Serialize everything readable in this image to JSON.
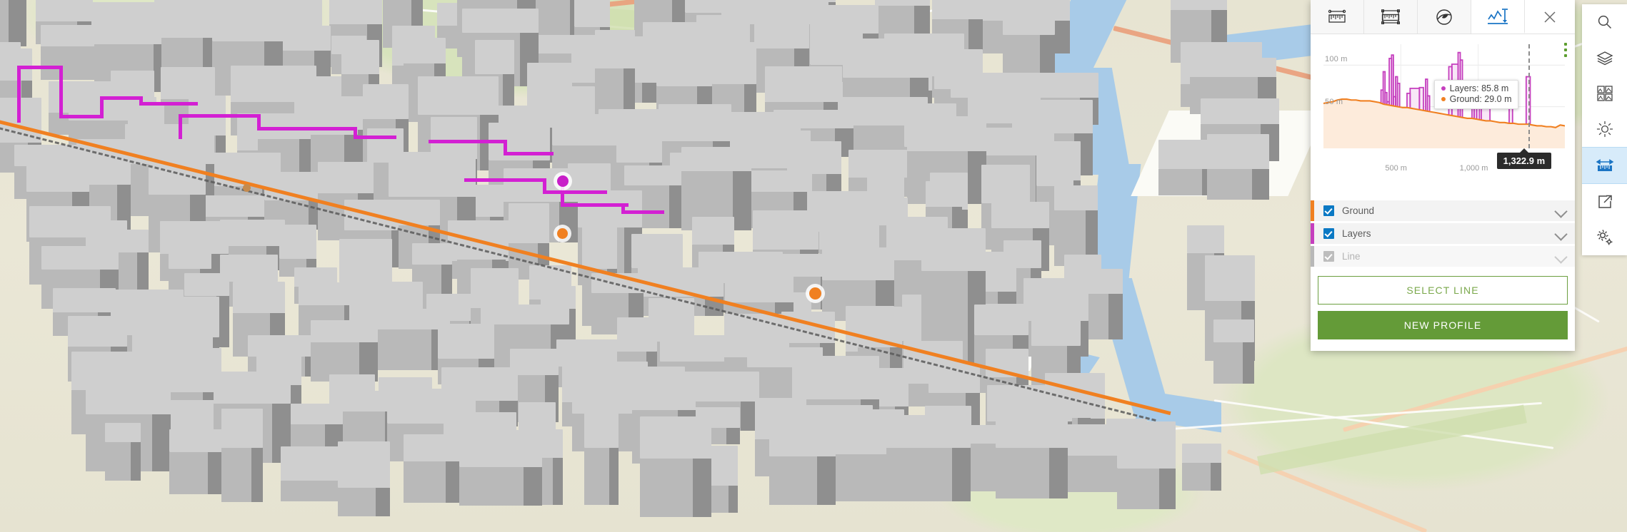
{
  "panel": {
    "tabs": [
      {
        "id": "direct-line-measurement",
        "label": "Direct line measurement",
        "icon": "ruler-icon",
        "active": false
      },
      {
        "id": "area-measurement",
        "label": "Area measurement",
        "icon": "area-ruler-icon",
        "active": false
      },
      {
        "id": "slice",
        "label": "Slice",
        "icon": "slice-icon",
        "active": false
      },
      {
        "id": "elevation-profile",
        "label": "Elevation profile",
        "icon": "elevation-profile-icon",
        "active": true
      }
    ],
    "close_label": "Close",
    "menu_label": "More options",
    "legend": [
      {
        "name": "Ground",
        "color": "#f08021",
        "checked": true,
        "enabled": true
      },
      {
        "name": "Layers",
        "color": "#c53fbe",
        "checked": true,
        "enabled": true
      },
      {
        "name": "Line",
        "color": "#b8b8b8",
        "checked": true,
        "enabled": false
      }
    ],
    "buttons": {
      "select_line": "SELECT LINE",
      "new_profile": "NEW PROFILE"
    },
    "tooltip": {
      "layers_label": "Layers: 85.8 m",
      "ground_label": "Ground: 29.0 m",
      "layers_color": "#c53fbe",
      "ground_color": "#f08021"
    },
    "hover_distance": "1,322.9 m"
  },
  "rail": {
    "items": [
      {
        "id": "search",
        "label": "Search",
        "icon": "search-icon",
        "active": false
      },
      {
        "id": "layers",
        "label": "Layers",
        "icon": "layers-icon",
        "active": false
      },
      {
        "id": "basemap",
        "label": "Basemap gallery",
        "icon": "basemap-gallery-icon",
        "active": false
      },
      {
        "id": "daylight",
        "label": "Daylight",
        "icon": "sun-icon",
        "active": false
      },
      {
        "id": "measurement",
        "label": "Measurement",
        "icon": "measurement-icon",
        "active": true
      },
      {
        "id": "share",
        "label": "Share",
        "icon": "share-icon",
        "active": false
      },
      {
        "id": "settings",
        "label": "Settings",
        "icon": "settings-gear-icon",
        "active": false
      }
    ]
  },
  "chart_data": {
    "type": "area",
    "title": "",
    "xlabel": "",
    "ylabel": "",
    "xlim": [
      0,
      1560
    ],
    "ylim": [
      0,
      125
    ],
    "grid": true,
    "legend_position": "below",
    "yticks": [
      50,
      100
    ],
    "ytick_labels": [
      "50 m",
      "100 m"
    ],
    "xticks": [
      500,
      1000
    ],
    "xtick_labels": [
      "500 m",
      "1,000 m"
    ],
    "cursor": {
      "x": 1322.9,
      "label": "1,322.9 m",
      "layers": 85.8,
      "ground": 29.0
    },
    "series": [
      {
        "name": "Ground",
        "color": "#f08021",
        "fill": "#fdebdb",
        "x": [
          0,
          30,
          60,
          90,
          120,
          150,
          180,
          210,
          240,
          270,
          300,
          330,
          360,
          390,
          420,
          450,
          480,
          510,
          540,
          570,
          600,
          630,
          660,
          690,
          720,
          750,
          780,
          810,
          840,
          870,
          900,
          930,
          960,
          990,
          1020,
          1050,
          1080,
          1110,
          1140,
          1170,
          1200,
          1230,
          1260,
          1290,
          1322,
          1350,
          1380,
          1410,
          1440,
          1470,
          1500,
          1530,
          1560
        ],
        "y": [
          54,
          55,
          56,
          58,
          59,
          59,
          58,
          58,
          57,
          57,
          57,
          56,
          55,
          53,
          52,
          51,
          50,
          49,
          49,
          48,
          47,
          46,
          45,
          44,
          43,
          42,
          41,
          40,
          39,
          38,
          37,
          36,
          36,
          35,
          34,
          33,
          33,
          32,
          31,
          31,
          30,
          30,
          29,
          29,
          29,
          28,
          27,
          27,
          26,
          26,
          25,
          28,
          27
        ]
      },
      {
        "name": "Layers",
        "color": "#c53fbe",
        "fill": "#f8e7f7",
        "buildings": [
          {
            "x0": 372,
            "x1": 386,
            "h": 70
          },
          {
            "x0": 386,
            "x1": 398,
            "h": 92
          },
          {
            "x0": 398,
            "x1": 410,
            "h": 67
          },
          {
            "x0": 410,
            "x1": 425,
            "h": 56
          },
          {
            "x0": 425,
            "x1": 440,
            "h": 108
          },
          {
            "x0": 440,
            "x1": 452,
            "h": 112
          },
          {
            "x0": 452,
            "x1": 466,
            "h": 62
          },
          {
            "x0": 466,
            "x1": 478,
            "h": 86
          },
          {
            "x0": 478,
            "x1": 492,
            "h": 78
          },
          {
            "x0": 540,
            "x1": 560,
            "h": 66
          },
          {
            "x0": 560,
            "x1": 620,
            "h": 72
          },
          {
            "x0": 620,
            "x1": 646,
            "h": 73
          },
          {
            "x0": 660,
            "x1": 672,
            "h": 83
          },
          {
            "x0": 672,
            "x1": 686,
            "h": 63
          },
          {
            "x0": 810,
            "x1": 830,
            "h": 98
          },
          {
            "x0": 830,
            "x1": 870,
            "h": 101
          },
          {
            "x0": 870,
            "x1": 884,
            "h": 115
          },
          {
            "x0": 884,
            "x1": 898,
            "h": 106
          },
          {
            "x0": 960,
            "x1": 974,
            "h": 78
          },
          {
            "x0": 974,
            "x1": 990,
            "h": 66
          },
          {
            "x0": 990,
            "x1": 1008,
            "h": 80
          },
          {
            "x0": 1020,
            "x1": 1076,
            "h": 72
          },
          {
            "x0": 1200,
            "x1": 1222,
            "h": 62
          },
          {
            "x0": 1310,
            "x1": 1336,
            "h": 86
          }
        ]
      }
    ]
  }
}
